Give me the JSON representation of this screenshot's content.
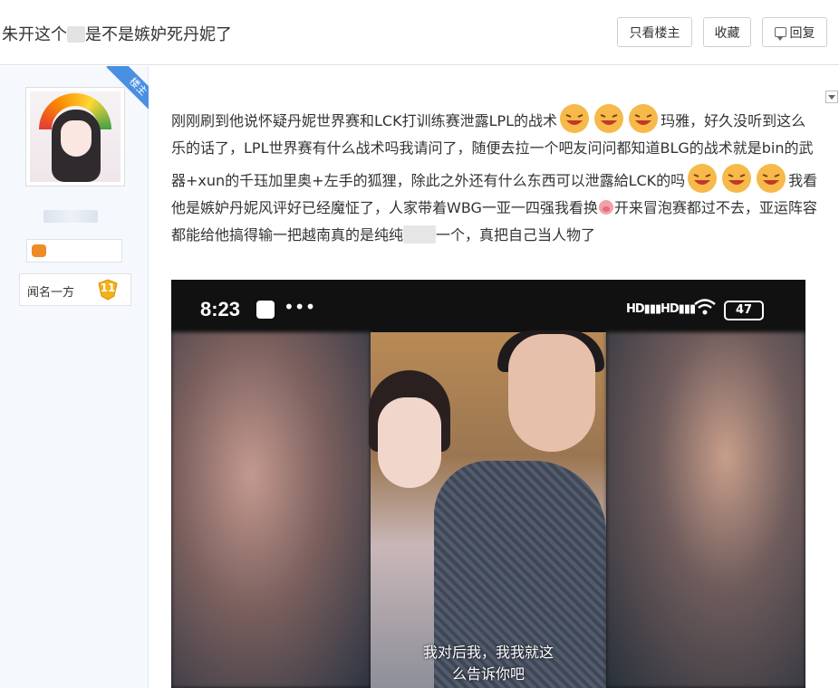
{
  "header": {
    "title_prefix": "朱开这个",
    "title_suffix": "是不是嫉妒死丹妮了",
    "only_op_label": "只看楼主",
    "favorite_label": "收藏",
    "reply_label": "回复"
  },
  "author": {
    "op_badge": "楼主",
    "tag_label": "闻名一方",
    "level": "11"
  },
  "post": {
    "line1": "刚刚刷到他说怀疑丹妮世界赛和LCK打训练赛泄露LPL的战术",
    "line1_tail": "玛雅，好久没听到这么乐的话了，LPL世界赛有什么战术吗我请问了，随便去拉一个吧友问问都知道BLG的战术就是bin的武器+xun的千珏加里奥+左手的狐狸，除此之外还有什么东西可以泄露給LCK的吗",
    "line2": "我看他是嫉妒丹妮风评好已经魔怔了，人家带着WBG一亚一四强我看换",
    "line3": "开来冒泡赛都过不去，亚运阵容都能给他搞得输一把越南真的是纯纯",
    "line3_tail": "一个，真把自己当人物了"
  },
  "screenshot": {
    "time": "8:23",
    "signal1": "HD",
    "signal2": "HD",
    "battery": "47",
    "caption_line1": "我对后我，我我就这",
    "caption_line2": "么告诉你吧"
  },
  "icons": {
    "emoji": "grinning-face-emoji",
    "pig": "pig-emoji"
  }
}
